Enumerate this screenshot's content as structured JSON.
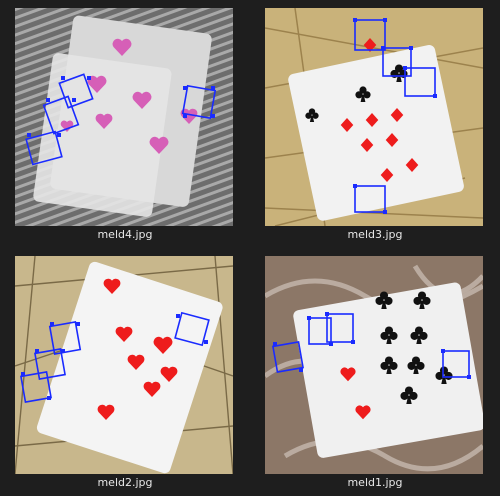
{
  "gallery": {
    "files": [
      {
        "name": "meld4.jpg"
      },
      {
        "name": "meld3.jpg"
      },
      {
        "name": "meld2.jpg"
      },
      {
        "name": "meld1.jpg"
      }
    ]
  },
  "colors": {
    "window_bg": "#1e1e1e",
    "label_text": "#e8e8e8",
    "box_stroke": "#1a2bff",
    "heart_pink": "#d65fb7",
    "heart_red": "#ee1c1c",
    "club_black": "#111111"
  },
  "icons": [
    "thumbnail-image",
    "bounding-box",
    "heart-pip",
    "diamond-pip",
    "club-pip"
  ]
}
